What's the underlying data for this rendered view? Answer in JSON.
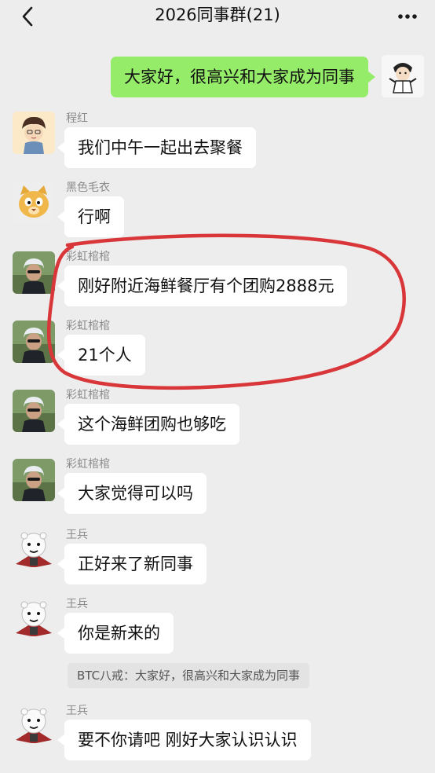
{
  "header": {
    "title": "2026同事群(21)",
    "back_icon": "chevron-left-icon",
    "more_icon": "more-dots-icon"
  },
  "colors": {
    "background": "#ededed",
    "bubble_in": "#ffffff",
    "bubble_out": "#95ec69",
    "highlight_ring": "#d9363a"
  },
  "messages": [
    {
      "sender": "",
      "avatar": "cartoon-figure-avatar",
      "outgoing": true,
      "text": "大家好，很高兴和大家成为同事"
    },
    {
      "sender": "程红",
      "avatar": "cartoon-boy-avatar",
      "outgoing": false,
      "text": "我们中午一起出去聚餐"
    },
    {
      "sender": "黑色毛衣",
      "avatar": "cat-face-avatar",
      "outgoing": false,
      "text": "行啊"
    },
    {
      "sender": "彩虹棺棺",
      "avatar": "photo-person-avatar",
      "outgoing": false,
      "text": "刚好附近海鲜餐厅有个团购2888元"
    },
    {
      "sender": "彩虹棺棺",
      "avatar": "photo-person-avatar",
      "outgoing": false,
      "text": "21个人"
    },
    {
      "sender": "彩虹棺棺",
      "avatar": "photo-person-avatar",
      "outgoing": false,
      "text": "这个海鲜团购也够吃"
    },
    {
      "sender": "彩虹棺棺",
      "avatar": "photo-person-avatar",
      "outgoing": false,
      "text": "大家觉得可以吗"
    },
    {
      "sender": "王兵",
      "avatar": "meme-bear-avatar",
      "outgoing": false,
      "text": "正好来了新同事"
    },
    {
      "sender": "王兵",
      "avatar": "meme-bear-avatar",
      "outgoing": false,
      "text": "你是新来的"
    },
    {
      "sender": "王兵",
      "avatar": "meme-bear-avatar",
      "outgoing": false,
      "text": "要不你请吧  刚好大家认识认识"
    }
  ],
  "quote": {
    "text": "BTC八戒：大家好，很高兴和大家成为同事"
  }
}
